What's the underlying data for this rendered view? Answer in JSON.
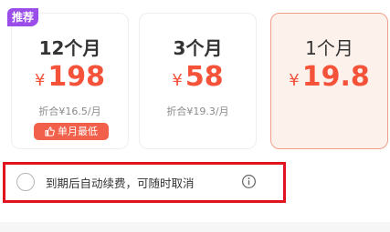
{
  "plans": [
    {
      "duration": "12个月",
      "currency": "¥",
      "price": "198",
      "per_month": "折合¥16.5/月",
      "badge": "推荐",
      "tag": "单月最低",
      "selected": false
    },
    {
      "duration": "3个月",
      "currency": "¥",
      "price": "58",
      "per_month": "折合¥19.3/月",
      "selected": false
    },
    {
      "duration": "1个月",
      "currency": "¥",
      "price": "19.8",
      "selected": true
    }
  ],
  "auto_renew": {
    "label": "到期后自动续费，可随时取消",
    "checked": false,
    "info_icon": "info-icon"
  },
  "colors": {
    "accent": "#f4533a",
    "badge": "#9a4de8",
    "tag": "#f0604a",
    "highlight_border": "#e0141e",
    "selected_bg": "#fdf1ec"
  }
}
